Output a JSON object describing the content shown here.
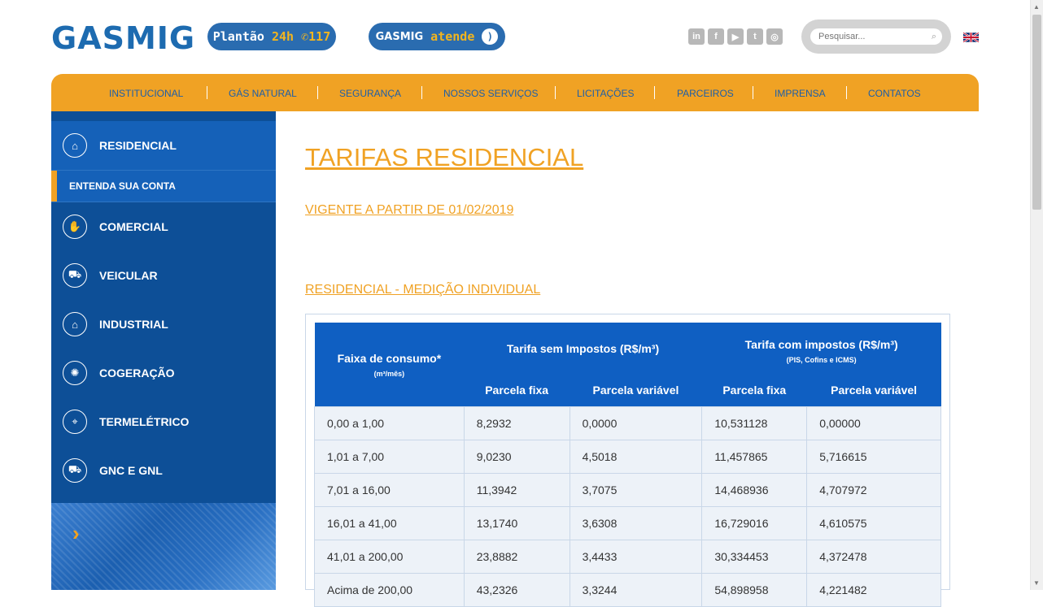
{
  "header": {
    "logo": "GASMIG",
    "plantao": {
      "label": "Plantão",
      "hours": "24h",
      "phone": "117"
    },
    "atende": {
      "brand": "GASMIG",
      "label": "atende"
    },
    "socials": [
      "linkedin-icon",
      "facebook-icon",
      "youtube-icon",
      "twitter-icon",
      "instagram-icon"
    ],
    "search": {
      "placeholder": "Pesquisar..."
    },
    "language_flag": "uk-flag-icon"
  },
  "nav": {
    "items": [
      "INSTITUCIONAL",
      "GÁS NATURAL",
      "SEGURANÇA",
      "NOSSOS SERVIÇOS",
      "LICITAÇÕES",
      "PARCEIROS",
      "IMPRENSA",
      "CONTATOS"
    ]
  },
  "sidebar": {
    "items": [
      {
        "label": "RESIDENCIAL",
        "icon": "house-icon"
      },
      {
        "label": "COMERCIAL",
        "icon": "handshake-icon"
      },
      {
        "label": "VEICULAR",
        "icon": "truck-icon"
      },
      {
        "label": "INDUSTRIAL",
        "icon": "factory-icon"
      },
      {
        "label": "COGERAÇÃO",
        "icon": "lightbulb-icon"
      },
      {
        "label": "TERMELÉTRICO",
        "icon": "plant-icon"
      },
      {
        "label": "GNC E GNL",
        "icon": "tanker-icon"
      }
    ],
    "sub_item": "ENTENDA SUA CONTA",
    "arrow": "›"
  },
  "main": {
    "title": "TARIFAS RESIDENCIAL",
    "vigente": "VIGENTE A PARTIR DE 01/02/2019",
    "section": "RESIDENCIAL - MEDIÇÃO INDIVIDUAL",
    "table": {
      "col1_header": "Faixa de consumo*",
      "col1_unit": "(m³/mês)",
      "group1": "Tarifa sem Impostos (R$/m³)",
      "group2": "Tarifa com impostos (R$/m³)",
      "group2_note": "(PIS, Cofins e ICMS)",
      "sub_fixa": "Parcela fixa",
      "sub_variavel": "Parcela variável",
      "rows": [
        [
          "0,00 a 1,00",
          "8,2932",
          "0,0000",
          "10,531128",
          "0,00000"
        ],
        [
          "1,01 a 7,00",
          "9,0230",
          "4,5018",
          "11,457865",
          "5,716615"
        ],
        [
          "7,01 a 16,00",
          "11,3942",
          "3,7075",
          "14,468936",
          "4,707972"
        ],
        [
          "16,01 a 41,00",
          "13,1740",
          "3,6308",
          "16,729016",
          "4,610575"
        ],
        [
          "41,01 a 200,00",
          "23,8882",
          "3,4433",
          "30,334453",
          "4,372478"
        ],
        [
          "Acima de 200,00",
          "43,2326",
          "3,3244",
          "54,898958",
          "4,221482"
        ]
      ]
    }
  }
}
